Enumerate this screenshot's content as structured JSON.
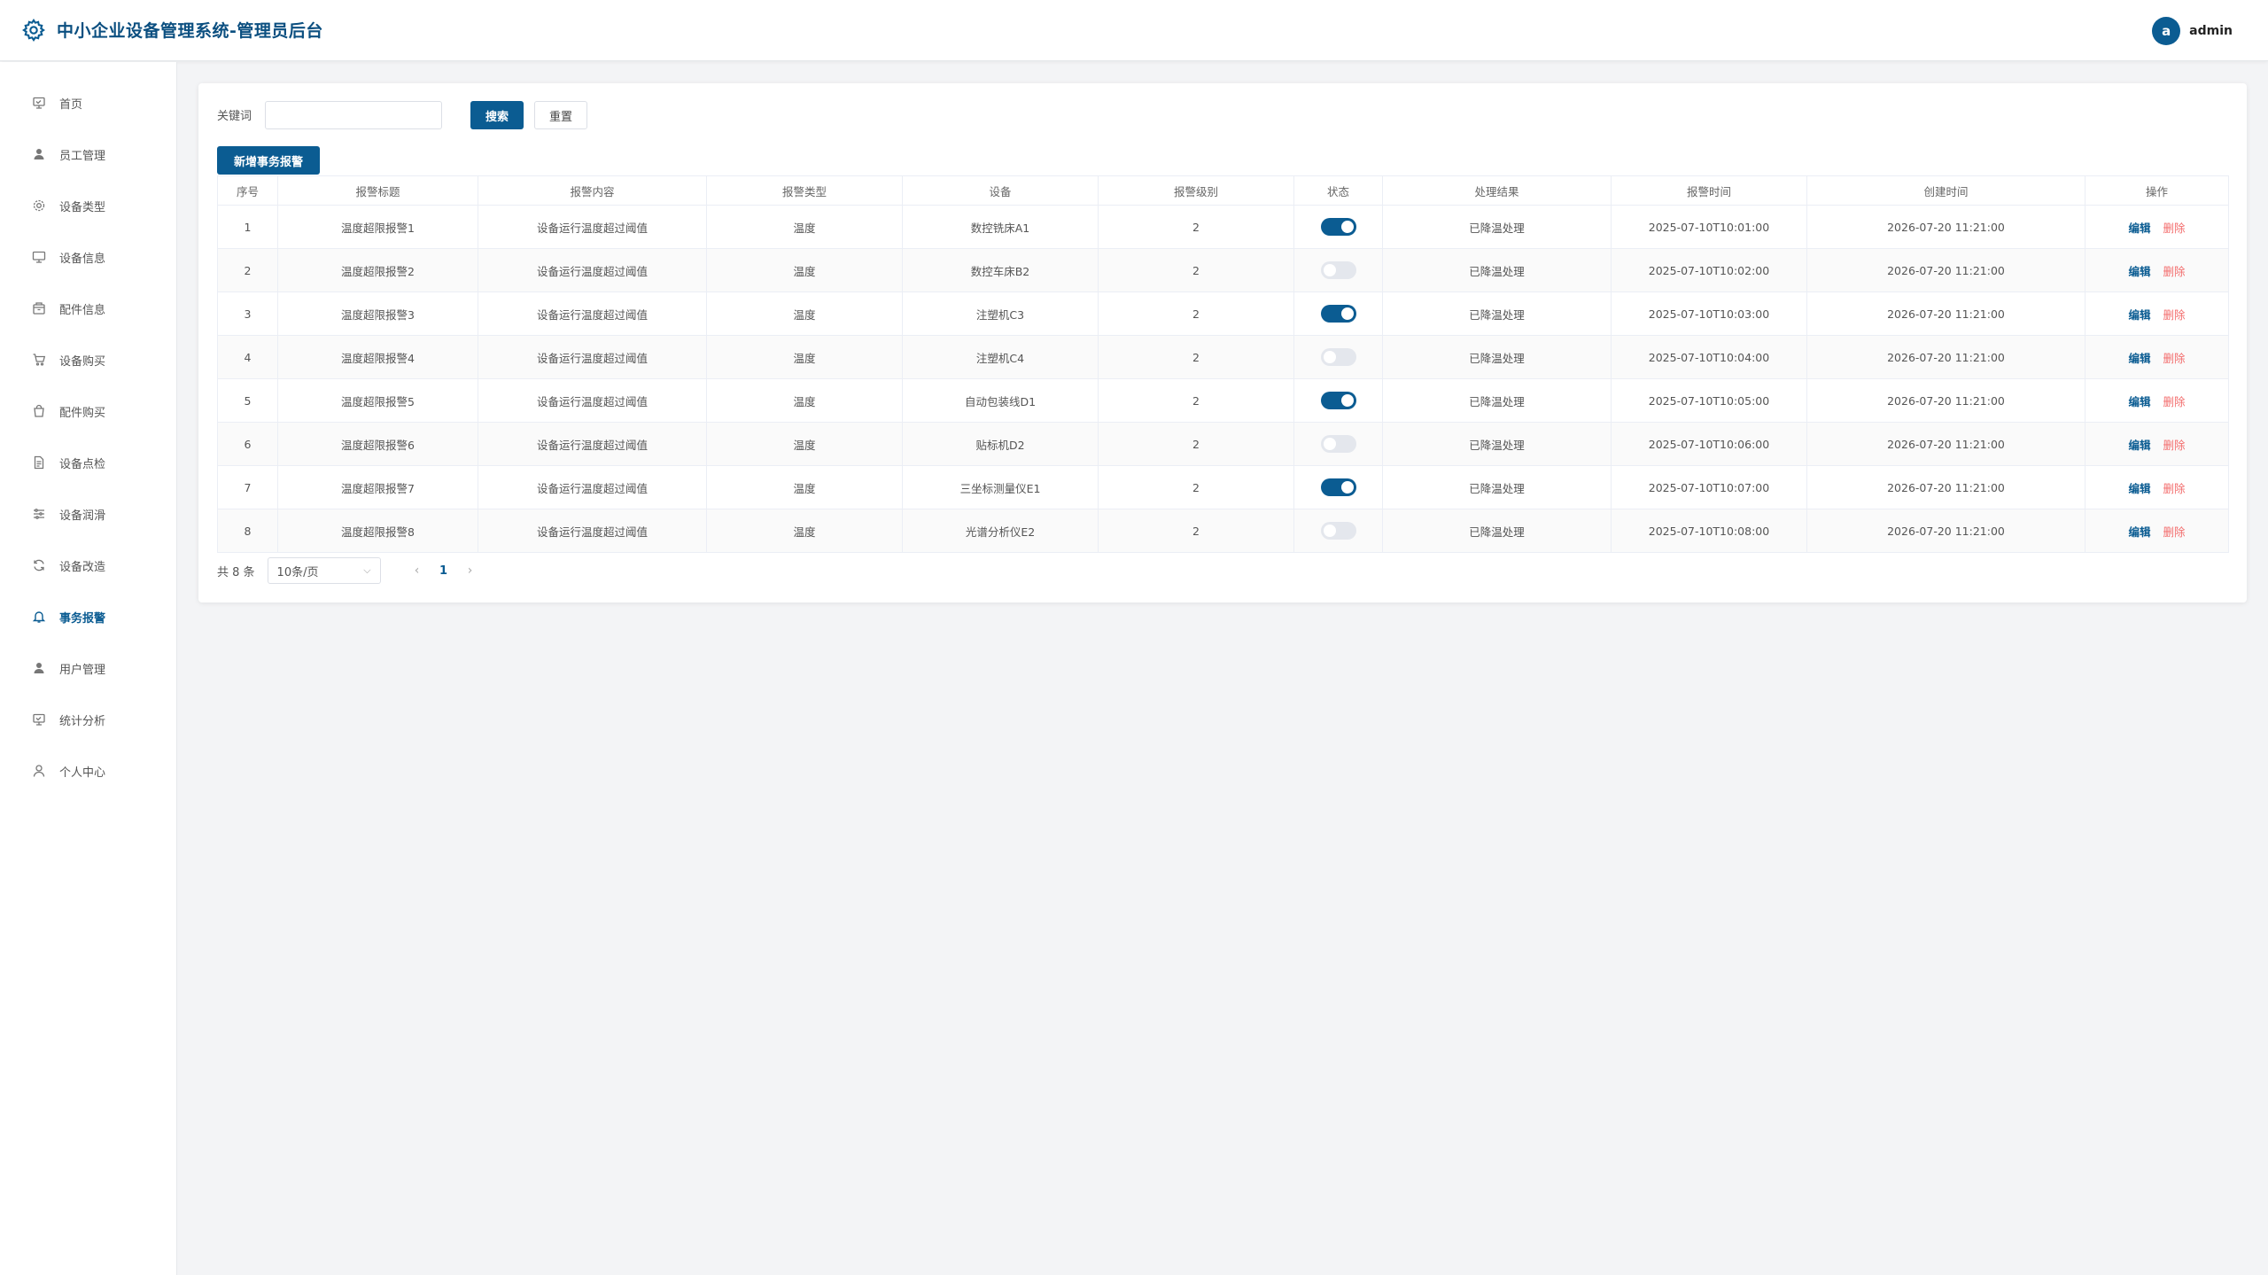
{
  "header": {
    "title": "中小企业设备管理系统-管理员后台",
    "avatar_letter": "a",
    "username": "admin"
  },
  "sidebar": {
    "items": [
      {
        "label": "首页",
        "icon": "monitor-icon"
      },
      {
        "label": "员工管理",
        "icon": "user-icon"
      },
      {
        "label": "设备类型",
        "icon": "gear-icon"
      },
      {
        "label": "设备信息",
        "icon": "display-icon"
      },
      {
        "label": "配件信息",
        "icon": "box-icon"
      },
      {
        "label": "设备购买",
        "icon": "cart-icon"
      },
      {
        "label": "配件购买",
        "icon": "bag-icon"
      },
      {
        "label": "设备点检",
        "icon": "document-icon"
      },
      {
        "label": "设备润滑",
        "icon": "sliders-icon"
      },
      {
        "label": "设备改造",
        "icon": "refresh-icon"
      },
      {
        "label": "事务报警",
        "icon": "bell-icon"
      },
      {
        "label": "用户管理",
        "icon": "user-icon"
      },
      {
        "label": "统计分析",
        "icon": "monitor-icon"
      },
      {
        "label": "个人中心",
        "icon": "user-outline-icon"
      }
    ],
    "active_index": 10
  },
  "search": {
    "label": "关键词",
    "value": "",
    "placeholder": "",
    "search_button": "搜索",
    "reset_button": "重置"
  },
  "add_button": "新增事务报警",
  "table": {
    "columns": [
      "序号",
      "报警标题",
      "报警内容",
      "报警类型",
      "设备",
      "报警级别",
      "状态",
      "处理结果",
      "报警时间",
      "创建时间",
      "操作"
    ],
    "rows": [
      {
        "no": "1",
        "title": "温度超限报警1",
        "content": "设备运行温度超过阈值",
        "type": "温度",
        "device": "数控铣床A1",
        "level": "2",
        "status": true,
        "result": "已降温处理",
        "alarm_time": "2025-07-10T10:01:00",
        "created": "2026-07-20 11:21:00"
      },
      {
        "no": "2",
        "title": "温度超限报警2",
        "content": "设备运行温度超过阈值",
        "type": "温度",
        "device": "数控车床B2",
        "level": "2",
        "status": false,
        "result": "已降温处理",
        "alarm_time": "2025-07-10T10:02:00",
        "created": "2026-07-20 11:21:00"
      },
      {
        "no": "3",
        "title": "温度超限报警3",
        "content": "设备运行温度超过阈值",
        "type": "温度",
        "device": "注塑机C3",
        "level": "2",
        "status": true,
        "result": "已降温处理",
        "alarm_time": "2025-07-10T10:03:00",
        "created": "2026-07-20 11:21:00"
      },
      {
        "no": "4",
        "title": "温度超限报警4",
        "content": "设备运行温度超过阈值",
        "type": "温度",
        "device": "注塑机C4",
        "level": "2",
        "status": false,
        "result": "已降温处理",
        "alarm_time": "2025-07-10T10:04:00",
        "created": "2026-07-20 11:21:00"
      },
      {
        "no": "5",
        "title": "温度超限报警5",
        "content": "设备运行温度超过阈值",
        "type": "温度",
        "device": "自动包装线D1",
        "level": "2",
        "status": true,
        "result": "已降温处理",
        "alarm_time": "2025-07-10T10:05:00",
        "created": "2026-07-20 11:21:00"
      },
      {
        "no": "6",
        "title": "温度超限报警6",
        "content": "设备运行温度超过阈值",
        "type": "温度",
        "device": "贴标机D2",
        "level": "2",
        "status": false,
        "result": "已降温处理",
        "alarm_time": "2025-07-10T10:06:00",
        "created": "2026-07-20 11:21:00"
      },
      {
        "no": "7",
        "title": "温度超限报警7",
        "content": "设备运行温度超过阈值",
        "type": "温度",
        "device": "三坐标测量仪E1",
        "level": "2",
        "status": true,
        "result": "已降温处理",
        "alarm_time": "2025-07-10T10:07:00",
        "created": "2026-07-20 11:21:00"
      },
      {
        "no": "8",
        "title": "温度超限报警8",
        "content": "设备运行温度超过阈值",
        "type": "温度",
        "device": "光谱分析仪E2",
        "level": "2",
        "status": false,
        "result": "已降温处理",
        "alarm_time": "2025-07-10T10:08:00",
        "created": "2026-07-20 11:21:00"
      }
    ],
    "actions": {
      "edit": "编辑",
      "delete": "删除"
    }
  },
  "pagination": {
    "total": "共 8 条",
    "page_size": "10条/页",
    "prev": "‹",
    "current": "1",
    "next": "›"
  },
  "colors": {
    "primary": "#0b5c92",
    "title": "#0b4f80",
    "danger": "#f36c6c"
  }
}
